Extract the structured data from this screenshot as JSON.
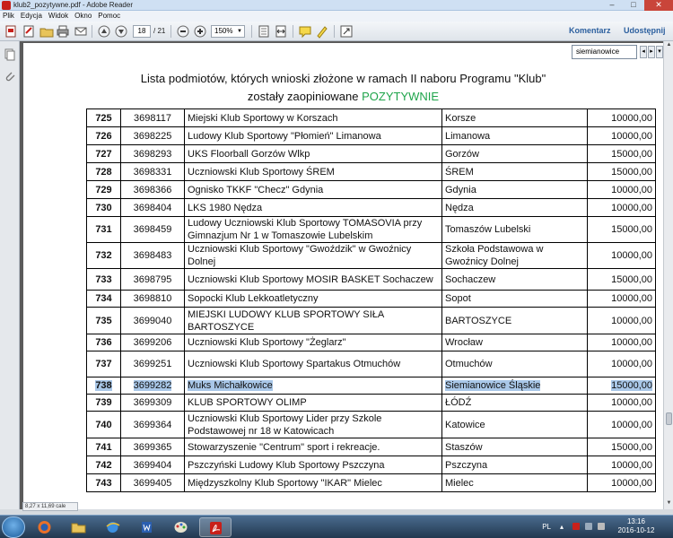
{
  "window": {
    "title": "klub2_pozytywne.pdf - Adobe Reader",
    "controls": {
      "minimize": "–",
      "maximize": "□",
      "close": "✕"
    }
  },
  "menu": [
    "Plik",
    "Edycja",
    "Widok",
    "Okno",
    "Pomoc"
  ],
  "toolbar": {
    "page_current": "18",
    "page_total": "/ 21",
    "zoom": "150%",
    "comment_label": "Komentarz",
    "share_label": "Udostępnij"
  },
  "find": {
    "query": "siemianowice",
    "prev": "◂",
    "next": "▸",
    "options": "▾"
  },
  "document": {
    "title_line1": "Lista podmiotów, których wnioski złożone w ramach II naboru Programu \"Klub\"",
    "title_line2_prefix": "zostały zaopiniowane ",
    "title_line2_highlight": "POZYTYWNIE",
    "positive_color": "#1ea44a",
    "rows": [
      {
        "lp": "725",
        "nr": "3698117",
        "name": "Miejski Klub Sportowy w Korszach",
        "city": "Korsze",
        "amount": "10000,00"
      },
      {
        "lp": "726",
        "nr": "3698225",
        "name": "Ludowy Klub Sportowy \"Płomień\" Limanowa",
        "city": "Limanowa",
        "amount": "10000,00"
      },
      {
        "lp": "727",
        "nr": "3698293",
        "name": "UKS Floorball Gorzów Wlkp",
        "city": "Gorzów",
        "amount": "15000,00"
      },
      {
        "lp": "728",
        "nr": "3698331",
        "name": "Uczniowski Klub Sportowy ŚREM",
        "city": "ŚREM",
        "amount": "15000,00"
      },
      {
        "lp": "729",
        "nr": "3698366",
        "name": "Ognisko TKKF \"Checz\" Gdynia",
        "city": "Gdynia",
        "amount": "10000,00"
      },
      {
        "lp": "730",
        "nr": "3698404",
        "name": "LKS 1980 Nędza",
        "city": "Nędza",
        "amount": "10000,00"
      },
      {
        "lp": "731",
        "nr": "3698459",
        "name": "Ludowy Uczniowski Klub Sportowy TOMASOVIA przy Gimnazjum Nr 1 w Tomaszowie Lubelskim",
        "city": "Tomaszów Lubelski",
        "amount": "15000,00"
      },
      {
        "lp": "732",
        "nr": "3698483",
        "name": "Uczniowski Klub Sportowy \"Gwoździk\" w Gwoźnicy Dolnej",
        "city": "Szkoła Podstawowa w Gwoźnicy Dolnej",
        "amount": "10000,00"
      },
      {
        "lp": "733",
        "nr": "3698795",
        "name": "Uczniowski Klub Sportowy MOSIR BASKET Sochaczew",
        "city": "Sochaczew",
        "amount": "15000,00"
      },
      {
        "lp": "734",
        "nr": "3698810",
        "name": "Sopocki Klub Lekkoatletyczny",
        "city": "Sopot",
        "amount": "10000,00"
      },
      {
        "lp": "735",
        "nr": "3699040",
        "name": "MIEJSKI LUDOWY KLUB SPORTOWY SIŁA BARTOSZYCE",
        "city": "BARTOSZYCE",
        "amount": "10000,00"
      },
      {
        "lp": "736",
        "nr": "3699206",
        "name": "Uczniowski Klub Sportowy \"Żeglarz\"",
        "city": "Wrocław",
        "amount": "10000,00"
      },
      {
        "lp": "737",
        "nr": "3699251",
        "name": "Uczniowski Klub Sportowy Spartakus Otmuchów",
        "city": "Otmuchów",
        "amount": "10000,00"
      },
      {
        "lp": "738",
        "nr": "3699282",
        "name": "Muks Michałkowice",
        "city": "Siemianowice Śląskie",
        "amount": "15000,00",
        "highlight": true
      },
      {
        "lp": "739",
        "nr": "3699309",
        "name": "KLUB SPORTOWY OLIMP",
        "city": "ŁÓDŹ",
        "amount": "10000,00"
      },
      {
        "lp": "740",
        "nr": "3699364",
        "name": "Uczniowski Klub Sportowy Lider przy Szkole Podstawowej nr 18 w Katowicach",
        "city": "Katowice",
        "amount": "10000,00"
      },
      {
        "lp": "741",
        "nr": "3699365",
        "name": "Stowarzyszenie \"Centrum\" sport i rekreacje.",
        "city": "Staszów",
        "amount": "15000,00"
      },
      {
        "lp": "742",
        "nr": "3699404",
        "name": "Pszczyński Ludowy Klub Sportowy Pszczyna",
        "city": "Pszczyna",
        "amount": "10000,00"
      },
      {
        "lp": "743",
        "nr": "3699405",
        "name": "Międzyszkolny Klub Sportowy \"IKAR\" Mielec",
        "city": "Mielec",
        "amount": "10000,00"
      }
    ]
  },
  "status": {
    "page_size": "8,27 x 11,69 cale"
  },
  "taskbar": {
    "lang": "PL",
    "time": "13:16",
    "date": "2016-10-12"
  },
  "colors": {
    "highlight": "#a9c7e8",
    "accent": "#2b5f9e"
  }
}
